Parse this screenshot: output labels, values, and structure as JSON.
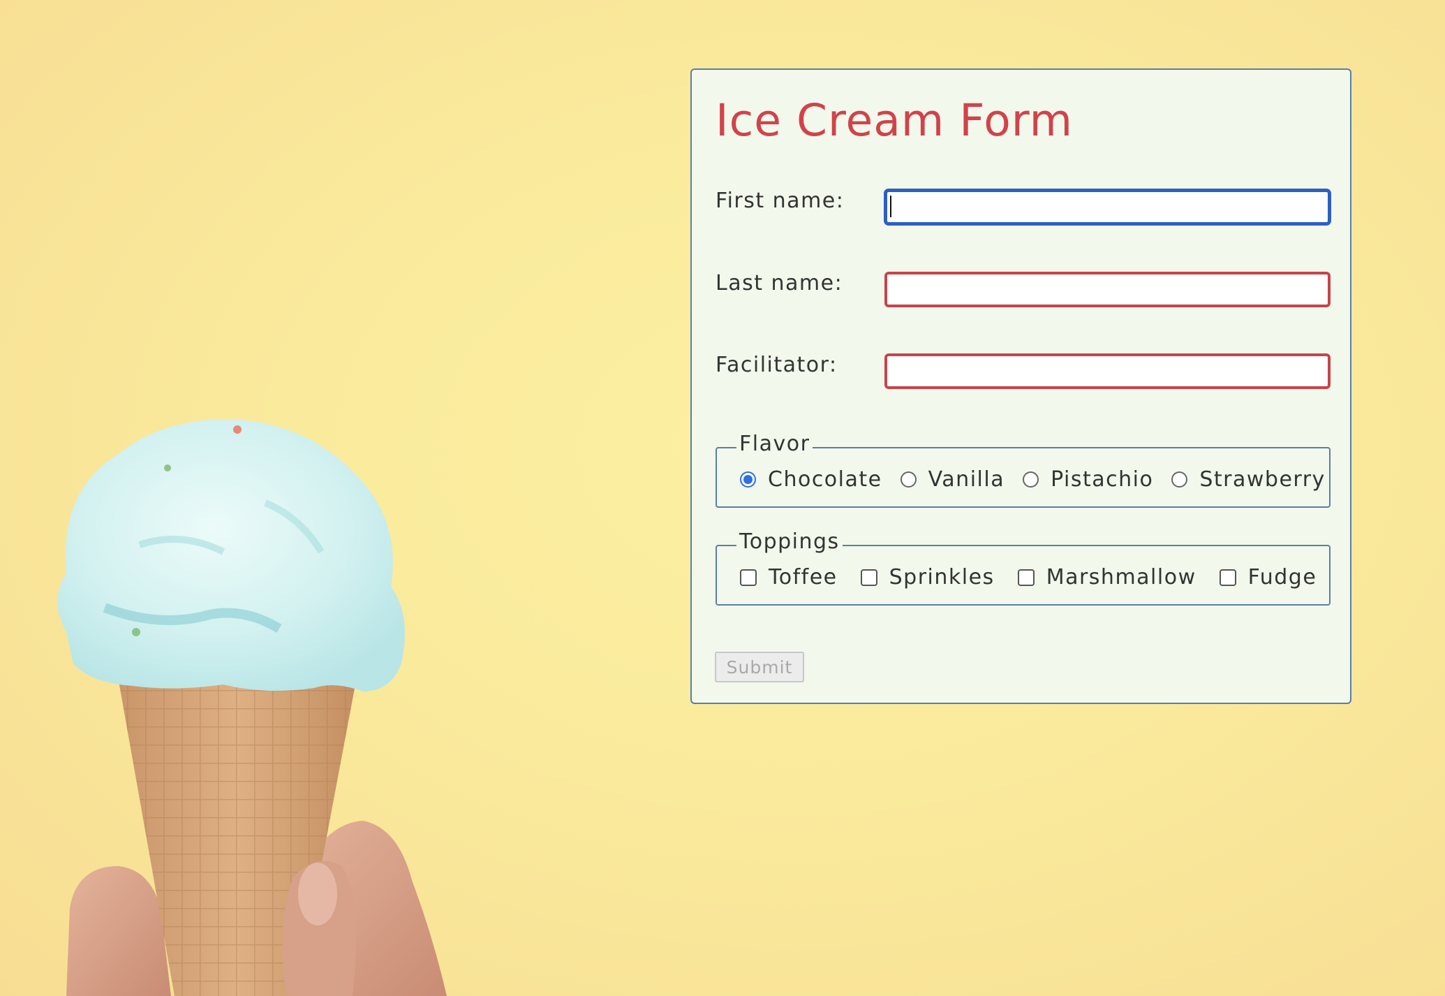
{
  "form": {
    "title": "Ice Cream Form",
    "fields": [
      {
        "label": "First name:",
        "value": "",
        "focused": true
      },
      {
        "label": "Last name:",
        "value": ""
      },
      {
        "label": "Facilitator:",
        "value": ""
      }
    ],
    "flavor": {
      "legend": "Flavor",
      "options": [
        "Chocolate",
        "Vanilla",
        "Pistachio",
        "Strawberry"
      ],
      "selected": "Chocolate"
    },
    "toppings": {
      "legend": "Toppings",
      "options": [
        "Toffee",
        "Sprinkles",
        "Marshmallow",
        "Fudge"
      ],
      "checked": []
    },
    "submit_label": "Submit",
    "submit_disabled": true
  },
  "colors": {
    "background": "#faea9c",
    "title": "#d0434a",
    "invalid_border": "#c5444b",
    "focus_border": "#2d5fc4",
    "card_background": "#f2f8ec",
    "card_border": "#5a7ea8"
  }
}
